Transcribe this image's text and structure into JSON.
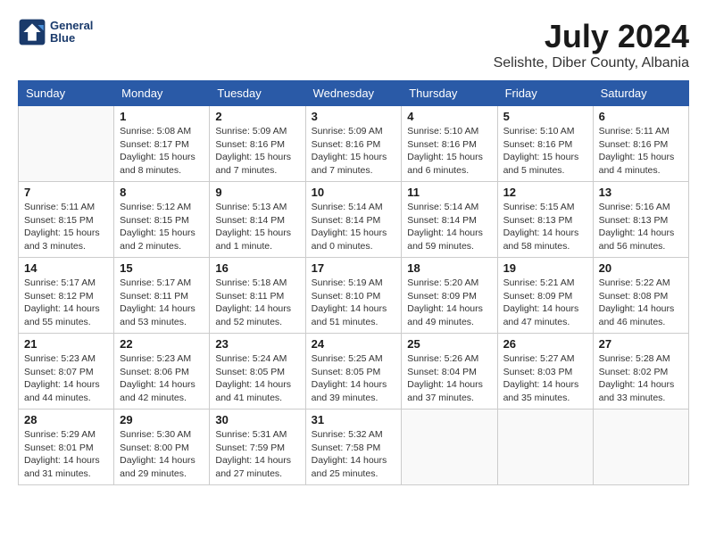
{
  "header": {
    "logo_line1": "General",
    "logo_line2": "Blue",
    "month_year": "July 2024",
    "location": "Selishte, Diber County, Albania"
  },
  "weekdays": [
    "Sunday",
    "Monday",
    "Tuesday",
    "Wednesday",
    "Thursday",
    "Friday",
    "Saturday"
  ],
  "weeks": [
    [
      {
        "day": "",
        "text": ""
      },
      {
        "day": "1",
        "text": "Sunrise: 5:08 AM\nSunset: 8:17 PM\nDaylight: 15 hours\nand 8 minutes."
      },
      {
        "day": "2",
        "text": "Sunrise: 5:09 AM\nSunset: 8:16 PM\nDaylight: 15 hours\nand 7 minutes."
      },
      {
        "day": "3",
        "text": "Sunrise: 5:09 AM\nSunset: 8:16 PM\nDaylight: 15 hours\nand 7 minutes."
      },
      {
        "day": "4",
        "text": "Sunrise: 5:10 AM\nSunset: 8:16 PM\nDaylight: 15 hours\nand 6 minutes."
      },
      {
        "day": "5",
        "text": "Sunrise: 5:10 AM\nSunset: 8:16 PM\nDaylight: 15 hours\nand 5 minutes."
      },
      {
        "day": "6",
        "text": "Sunrise: 5:11 AM\nSunset: 8:16 PM\nDaylight: 15 hours\nand 4 minutes."
      }
    ],
    [
      {
        "day": "7",
        "text": "Sunrise: 5:11 AM\nSunset: 8:15 PM\nDaylight: 15 hours\nand 3 minutes."
      },
      {
        "day": "8",
        "text": "Sunrise: 5:12 AM\nSunset: 8:15 PM\nDaylight: 15 hours\nand 2 minutes."
      },
      {
        "day": "9",
        "text": "Sunrise: 5:13 AM\nSunset: 8:14 PM\nDaylight: 15 hours\nand 1 minute."
      },
      {
        "day": "10",
        "text": "Sunrise: 5:14 AM\nSunset: 8:14 PM\nDaylight: 15 hours\nand 0 minutes."
      },
      {
        "day": "11",
        "text": "Sunrise: 5:14 AM\nSunset: 8:14 PM\nDaylight: 14 hours\nand 59 minutes."
      },
      {
        "day": "12",
        "text": "Sunrise: 5:15 AM\nSunset: 8:13 PM\nDaylight: 14 hours\nand 58 minutes."
      },
      {
        "day": "13",
        "text": "Sunrise: 5:16 AM\nSunset: 8:13 PM\nDaylight: 14 hours\nand 56 minutes."
      }
    ],
    [
      {
        "day": "14",
        "text": "Sunrise: 5:17 AM\nSunset: 8:12 PM\nDaylight: 14 hours\nand 55 minutes."
      },
      {
        "day": "15",
        "text": "Sunrise: 5:17 AM\nSunset: 8:11 PM\nDaylight: 14 hours\nand 53 minutes."
      },
      {
        "day": "16",
        "text": "Sunrise: 5:18 AM\nSunset: 8:11 PM\nDaylight: 14 hours\nand 52 minutes."
      },
      {
        "day": "17",
        "text": "Sunrise: 5:19 AM\nSunset: 8:10 PM\nDaylight: 14 hours\nand 51 minutes."
      },
      {
        "day": "18",
        "text": "Sunrise: 5:20 AM\nSunset: 8:09 PM\nDaylight: 14 hours\nand 49 minutes."
      },
      {
        "day": "19",
        "text": "Sunrise: 5:21 AM\nSunset: 8:09 PM\nDaylight: 14 hours\nand 47 minutes."
      },
      {
        "day": "20",
        "text": "Sunrise: 5:22 AM\nSunset: 8:08 PM\nDaylight: 14 hours\nand 46 minutes."
      }
    ],
    [
      {
        "day": "21",
        "text": "Sunrise: 5:23 AM\nSunset: 8:07 PM\nDaylight: 14 hours\nand 44 minutes."
      },
      {
        "day": "22",
        "text": "Sunrise: 5:23 AM\nSunset: 8:06 PM\nDaylight: 14 hours\nand 42 minutes."
      },
      {
        "day": "23",
        "text": "Sunrise: 5:24 AM\nSunset: 8:05 PM\nDaylight: 14 hours\nand 41 minutes."
      },
      {
        "day": "24",
        "text": "Sunrise: 5:25 AM\nSunset: 8:05 PM\nDaylight: 14 hours\nand 39 minutes."
      },
      {
        "day": "25",
        "text": "Sunrise: 5:26 AM\nSunset: 8:04 PM\nDaylight: 14 hours\nand 37 minutes."
      },
      {
        "day": "26",
        "text": "Sunrise: 5:27 AM\nSunset: 8:03 PM\nDaylight: 14 hours\nand 35 minutes."
      },
      {
        "day": "27",
        "text": "Sunrise: 5:28 AM\nSunset: 8:02 PM\nDaylight: 14 hours\nand 33 minutes."
      }
    ],
    [
      {
        "day": "28",
        "text": "Sunrise: 5:29 AM\nSunset: 8:01 PM\nDaylight: 14 hours\nand 31 minutes."
      },
      {
        "day": "29",
        "text": "Sunrise: 5:30 AM\nSunset: 8:00 PM\nDaylight: 14 hours\nand 29 minutes."
      },
      {
        "day": "30",
        "text": "Sunrise: 5:31 AM\nSunset: 7:59 PM\nDaylight: 14 hours\nand 27 minutes."
      },
      {
        "day": "31",
        "text": "Sunrise: 5:32 AM\nSunset: 7:58 PM\nDaylight: 14 hours\nand 25 minutes."
      },
      {
        "day": "",
        "text": ""
      },
      {
        "day": "",
        "text": ""
      },
      {
        "day": "",
        "text": ""
      }
    ]
  ]
}
